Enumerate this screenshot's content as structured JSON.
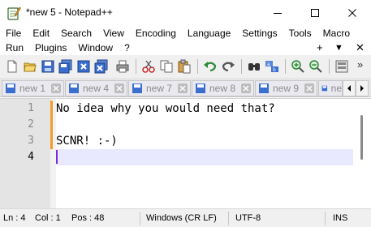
{
  "window": {
    "title": "*new 5 - Notepad++",
    "controls": [
      "minimize",
      "maximize",
      "close"
    ]
  },
  "menu": {
    "row1": [
      "File",
      "Edit",
      "Search",
      "View",
      "Encoding",
      "Language",
      "Settings",
      "Tools",
      "Macro"
    ],
    "row2": [
      "Run",
      "Plugins",
      "Window",
      "?"
    ],
    "extras": {
      "add": "+",
      "dropdown": "▼",
      "close": "✕"
    }
  },
  "toolbar": {
    "buttons": [
      "new-file-icon",
      "open-file-icon",
      "save-icon",
      "save-all-icon",
      "close-icon",
      "close-all-icon",
      "print-icon",
      "cut-icon",
      "copy-icon",
      "paste-icon",
      "undo-icon",
      "redo-icon",
      "find-icon",
      "replace-icon",
      "zoom-in-icon",
      "zoom-out-icon",
      "sync-scroll-icon"
    ]
  },
  "tabs": [
    {
      "label": "new 1"
    },
    {
      "label": "new 4"
    },
    {
      "label": "new 7"
    },
    {
      "label": "new 8"
    },
    {
      "label": "new 9"
    },
    {
      "label": "ne"
    }
  ],
  "editor": {
    "lines": [
      {
        "number": "1",
        "text": "No idea why you would need that?"
      },
      {
        "number": "2",
        "text": ""
      },
      {
        "number": "3",
        "text": "SCNR! :-)"
      },
      {
        "number": "4",
        "text": ""
      }
    ]
  },
  "status": {
    "line": "Ln : 4",
    "col": "Col : 1",
    "pos": "Pos : 48",
    "eol": "Windows (CR LF)",
    "encoding": "UTF-8",
    "mode": "INS"
  },
  "colors": {
    "accent_change": "#f59a2a",
    "caret": "#7a2bd6",
    "current_line": "#e8e8ff"
  }
}
